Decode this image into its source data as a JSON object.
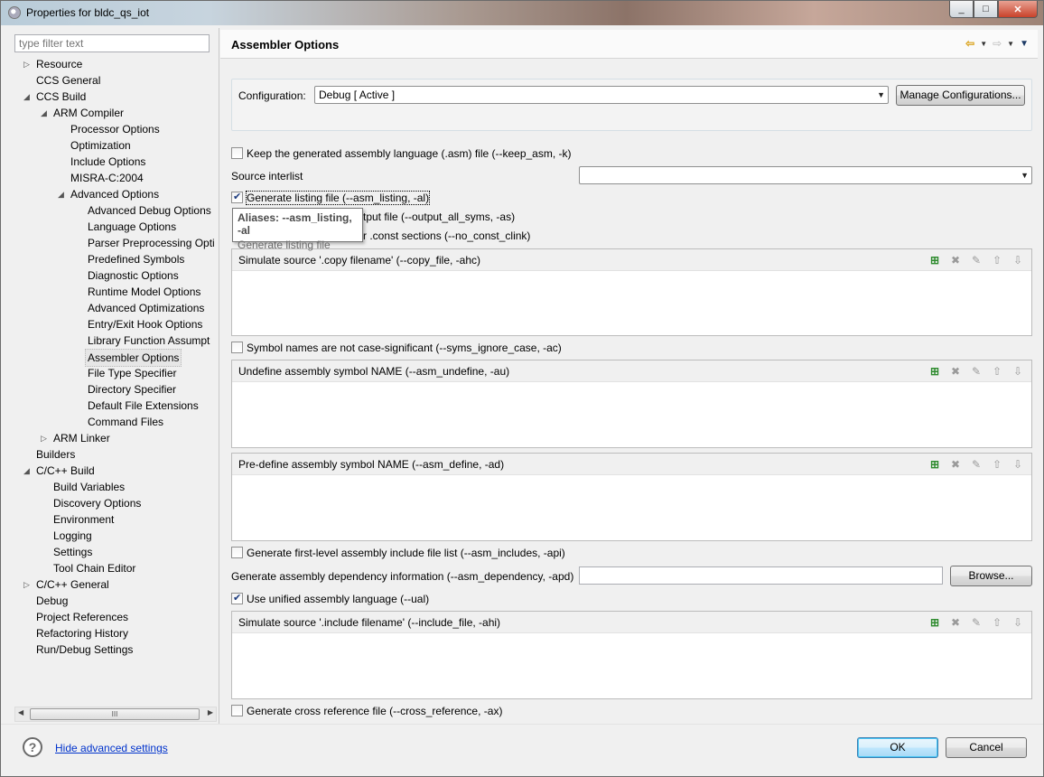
{
  "window": {
    "title": "Properties for bldc_qs_iot",
    "controls": [
      "_",
      "□",
      "✕"
    ]
  },
  "filter": {
    "placeholder": "type filter text"
  },
  "tree": [
    {
      "label": "Resource",
      "depth": 0,
      "arrow": "▷"
    },
    {
      "label": "CCS General",
      "depth": 0
    },
    {
      "label": "CCS Build",
      "depth": 0,
      "arrow": "◢"
    },
    {
      "label": "ARM Compiler",
      "depth": 1,
      "arrow": "◢"
    },
    {
      "label": "Processor Options",
      "depth": 2
    },
    {
      "label": "Optimization",
      "depth": 2
    },
    {
      "label": "Include Options",
      "depth": 2
    },
    {
      "label": "MISRA-C:2004",
      "depth": 2
    },
    {
      "label": "Advanced Options",
      "depth": 2,
      "arrow": "◢"
    },
    {
      "label": "Advanced Debug Options",
      "depth": 3
    },
    {
      "label": "Language Options",
      "depth": 3
    },
    {
      "label": "Parser Preprocessing Opti",
      "depth": 3
    },
    {
      "label": "Predefined Symbols",
      "depth": 3
    },
    {
      "label": "Diagnostic Options",
      "depth": 3
    },
    {
      "label": "Runtime Model Options",
      "depth": 3
    },
    {
      "label": "Advanced Optimizations",
      "depth": 3
    },
    {
      "label": "Entry/Exit Hook Options",
      "depth": 3
    },
    {
      "label": "Library Function Assumpt",
      "depth": 3
    },
    {
      "label": "Assembler Options",
      "depth": 3,
      "selected": true
    },
    {
      "label": "File Type Specifier",
      "depth": 3
    },
    {
      "label": "Directory Specifier",
      "depth": 3
    },
    {
      "label": "Default File Extensions",
      "depth": 3
    },
    {
      "label": "Command Files",
      "depth": 3
    },
    {
      "label": "ARM Linker",
      "depth": 1,
      "arrow": "▷"
    },
    {
      "label": "Builders",
      "depth": 0
    },
    {
      "label": "C/C++ Build",
      "depth": 0,
      "arrow": "◢"
    },
    {
      "label": "Build Variables",
      "depth": 1
    },
    {
      "label": "Discovery Options",
      "depth": 1
    },
    {
      "label": "Environment",
      "depth": 1
    },
    {
      "label": "Logging",
      "depth": 1
    },
    {
      "label": "Settings",
      "depth": 1
    },
    {
      "label": "Tool Chain Editor",
      "depth": 1
    },
    {
      "label": "C/C++ General",
      "depth": 0,
      "arrow": "▷"
    },
    {
      "label": "Debug",
      "depth": 0
    },
    {
      "label": "Project References",
      "depth": 0
    },
    {
      "label": "Refactoring History",
      "depth": 0
    },
    {
      "label": "Run/Debug Settings",
      "depth": 0
    }
  ],
  "page": {
    "title": "Assembler Options"
  },
  "config": {
    "label": "Configuration:",
    "value": "Debug  [ Active ]",
    "manage_button": "Manage Configurations..."
  },
  "options": {
    "keep_asm": {
      "label": "Keep the generated assembly language (.asm) file (--keep_asm, -k)",
      "checked": false
    },
    "source_interlist": {
      "label": "Source interlist",
      "value": ""
    },
    "asm_listing": {
      "label": "Generate listing file (--asm_listing, -al)",
      "checked": true
    },
    "output_all_syms_partial": "tput file (--output_all_syms, -as)",
    "no_const_clink_partial": "r .const sections (--no_const_clink)",
    "syms_ignore_case": {
      "label": "Symbol names are not case-significant (--syms_ignore_case, -ac)",
      "checked": false
    },
    "asm_includes": {
      "label": "Generate first-level assembly include file list (--asm_includes, -api)",
      "checked": false
    },
    "asm_dependency": {
      "label": "Generate assembly dependency information (--asm_dependency, -apd)",
      "value": "",
      "browse": "Browse..."
    },
    "ual": {
      "label": "Use unified assembly language (--ual)",
      "checked": true
    },
    "cross_reference": {
      "label": "Generate cross reference file (--cross_reference, -ax)",
      "checked": false
    }
  },
  "lists": {
    "copy_file": "Simulate source '.copy filename' (--copy_file, -ahc)",
    "asm_undefine": "Undefine assembly symbol NAME (--asm_undefine, -au)",
    "asm_define": "Pre-define assembly symbol NAME (--asm_define, -ad)",
    "include_file": "Simulate source '.include filename' (--include_file, -ahi)"
  },
  "tooltip": {
    "line1": "Aliases: --asm_listing, -al",
    "line2": "Generate listing file"
  },
  "footer": {
    "hide_link": "Hide advanced settings",
    "ok": "OK",
    "cancel": "Cancel"
  }
}
